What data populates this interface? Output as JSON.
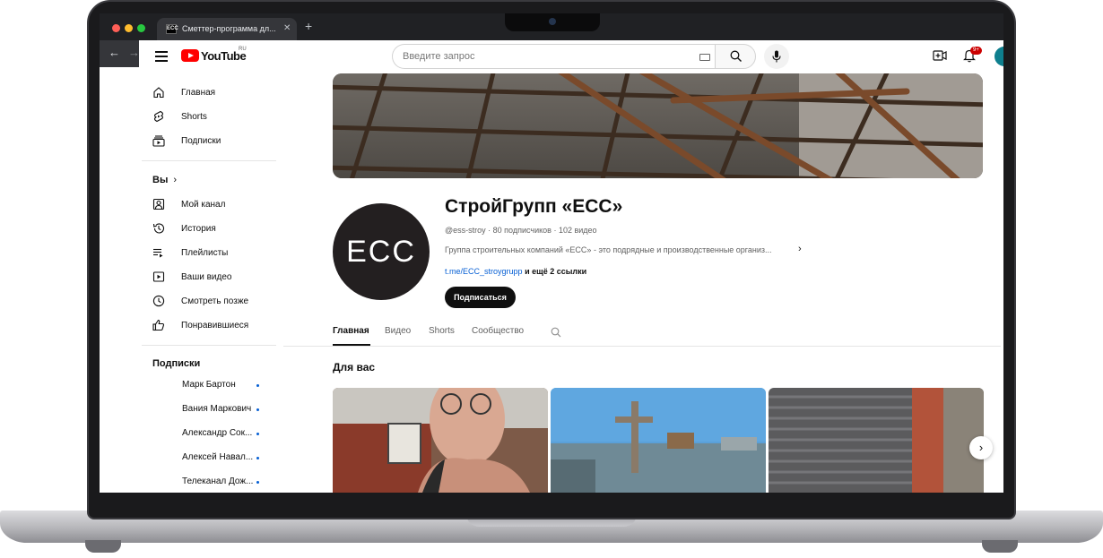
{
  "browser": {
    "tab_title": "Сметтер-программа дл...",
    "tab_favicon_text": "ECC"
  },
  "header": {
    "logo_text": "YouTube",
    "region": "RU",
    "search_placeholder": "Введите запрос",
    "notifications_badge": "9+"
  },
  "sidebar": {
    "main_items": [
      {
        "label": "Главная",
        "icon": "home-icon"
      },
      {
        "label": "Shorts",
        "icon": "shorts-icon"
      },
      {
        "label": "Подписки",
        "icon": "subscriptions-icon"
      }
    ],
    "you_heading": "Вы",
    "you_items": [
      {
        "label": "Мой канал",
        "icon": "your-channel-icon"
      },
      {
        "label": "История",
        "icon": "history-icon"
      },
      {
        "label": "Плейлисты",
        "icon": "playlists-icon"
      },
      {
        "label": "Ваши видео",
        "icon": "your-videos-icon"
      },
      {
        "label": "Смотреть позже",
        "icon": "watch-later-icon"
      },
      {
        "label": "Понравившиеся",
        "icon": "liked-icon"
      }
    ],
    "subscriptions_heading": "Подписки",
    "subscriptions": [
      {
        "label": "Марк Бартон"
      },
      {
        "label": "Вания Маркович"
      },
      {
        "label": "Александр Сок..."
      },
      {
        "label": "Алексей Навал..."
      },
      {
        "label": "Телеканал Дож..."
      }
    ]
  },
  "channel": {
    "avatar_text": "ECC",
    "name": "СтройГрупп «ЕСС»",
    "handle": "@ess-stroy",
    "subscribers": "80 подписчиков",
    "videos": "102 видео",
    "description": "Группа строительных компаний «ЕСС» - это подрядные и производственные организ...",
    "link": "t.me/ECC_stroygrupp",
    "more_links": "и ещё 2 ссылки",
    "subscribe_label": "Подписаться"
  },
  "tabs": [
    "Главная",
    "Видео",
    "Shorts",
    "Сообщество"
  ],
  "active_tab": "Главная",
  "section_title": "Для вас",
  "colors": {
    "brand_red": "#ff0000",
    "link_blue": "#065fd4",
    "text_primary": "#0f0f0f",
    "text_secondary": "#606060"
  }
}
